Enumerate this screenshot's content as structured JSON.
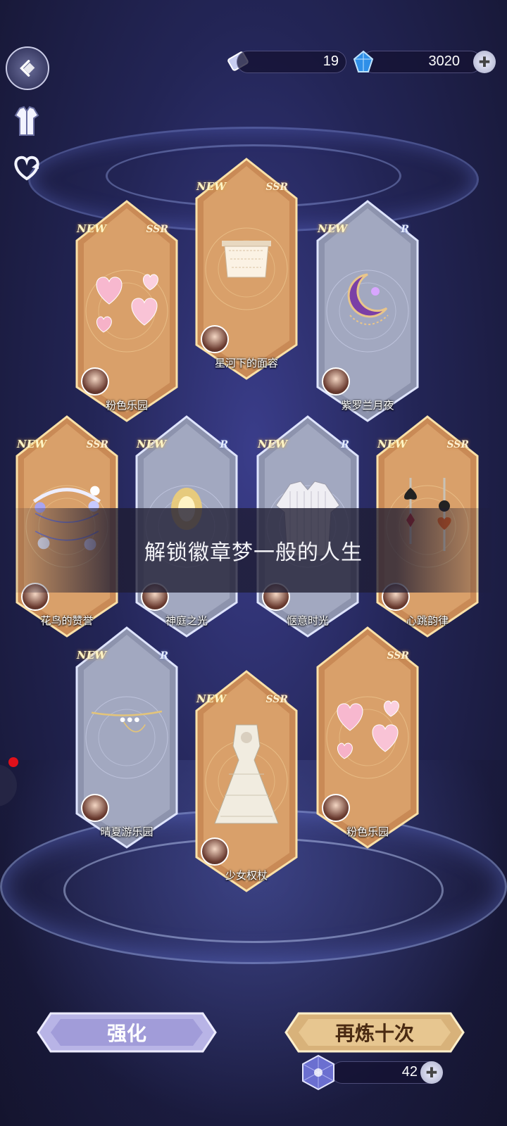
{
  "resources": {
    "ticket": {
      "icon": "ticket-icon",
      "value": "19"
    },
    "crystal": {
      "icon": "blue-crystal-icon",
      "value": "3020"
    }
  },
  "side_menu": [
    {
      "icon": "back-arrow-icon"
    },
    {
      "icon": "outfit-icon"
    },
    {
      "icon": "heart-refresh-icon"
    }
  ],
  "cards": [
    {
      "name": "粉色乐园",
      "rarity": "SSR",
      "is_new": true,
      "new_label": "NEW",
      "item_icon": "heart-balloons-icon"
    },
    {
      "name": "星河下的面容",
      "rarity": "SSR",
      "is_new": true,
      "new_label": "NEW",
      "item_icon": "lace-veil-icon"
    },
    {
      "name": "紫罗兰月夜",
      "rarity": "R",
      "is_new": true,
      "new_label": "NEW",
      "item_icon": "moon-brooch-icon"
    },
    {
      "name": "花鸟的赞誉",
      "rarity": "SSR",
      "is_new": true,
      "new_label": "NEW",
      "item_icon": "flower-wreath-icon"
    },
    {
      "name": "神庭之光",
      "rarity": "R",
      "is_new": true,
      "new_label": "NEW",
      "item_icon": "light-icon"
    },
    {
      "name": "惬意时光",
      "rarity": "R",
      "is_new": true,
      "new_label": "NEW",
      "item_icon": "shirt-icon"
    },
    {
      "name": "心跳韵律",
      "rarity": "SSR",
      "is_new": true,
      "new_label": "NEW",
      "item_icon": "card-earrings-icon"
    },
    {
      "name": "晴夏游乐园",
      "rarity": "R",
      "is_new": true,
      "new_label": "NEW",
      "item_icon": "necklace-icon"
    },
    {
      "name": "少女权杖",
      "rarity": "SSR",
      "is_new": true,
      "new_label": "NEW",
      "item_icon": "white-dress-icon"
    },
    {
      "name": "粉色乐园",
      "rarity": "SSR",
      "is_new": false,
      "new_label": "",
      "item_icon": "heart-balloons-icon"
    }
  ],
  "banner": {
    "text": "解锁徽章梦一般的人生"
  },
  "buttons": {
    "enhance": "强化",
    "redo_ten": "再炼十次"
  },
  "cost": {
    "icon": "star-cube-icon",
    "value": "42"
  },
  "colors": {
    "ssr_card": "#c98a56",
    "r_card": "#8d93ad",
    "enhance_button": "#b8b4e6",
    "redo_button": "#d8b27a"
  }
}
